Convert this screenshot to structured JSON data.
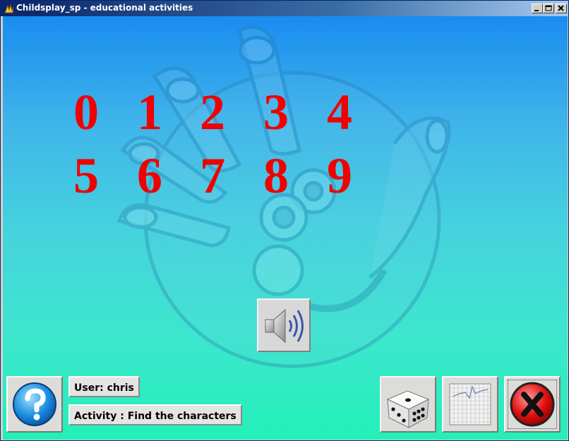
{
  "window": {
    "title": "Childsplay_sp - educational activities"
  },
  "board": {
    "row1": [
      "0",
      "1",
      "2",
      "3",
      "4"
    ],
    "row2": [
      "5",
      "6",
      "7",
      "8",
      "9"
    ],
    "digit_color": "#f00000"
  },
  "status": {
    "user": "User: chris",
    "activity": "Activity : Find the characters"
  },
  "controls": {
    "sound_icon": "speaker-icon",
    "help_icon": "question-mark-icon",
    "dice_icon": "dice-icon",
    "graph_icon": "graph-icon",
    "quit_icon": "close-x-icon"
  },
  "colors": {
    "title_bar": "#0a246a",
    "background_top": "#1a8cf0",
    "background_bottom": "#22f0b8"
  }
}
